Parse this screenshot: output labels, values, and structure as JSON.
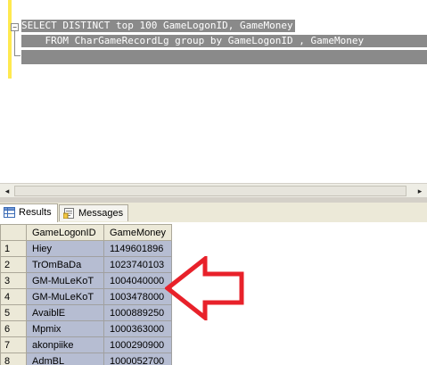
{
  "editor": {
    "sql_line1": "SELECT DISTINCT top 100 GameLogonID, GameMoney",
    "sql_line2": "    FROM CharGameRecordLg group by GameLogonID , GameMoney",
    "collapse_glyph": "−"
  },
  "scrollbar": {
    "left_arrow": "◂",
    "right_arrow": "▸"
  },
  "tabs": [
    {
      "label": "Results",
      "icon": "grid-icon",
      "active": true
    },
    {
      "label": "Messages",
      "icon": "messages-icon",
      "active": false
    }
  ],
  "results": {
    "columns": [
      "GameLogonID",
      "GameMoney"
    ],
    "rows": [
      {
        "num": "1",
        "logon_id": "Hiey",
        "money": "1149601896"
      },
      {
        "num": "2",
        "logon_id": "TrOmBaDa",
        "money": "1023740103"
      },
      {
        "num": "3",
        "logon_id": "GM-MuLeKoT",
        "money": "1004040000"
      },
      {
        "num": "4",
        "logon_id": "GM-MuLeKoT",
        "money": "1003478000"
      },
      {
        "num": "5",
        "logon_id": "AvaiblE",
        "money": "1000889250"
      },
      {
        "num": "6",
        "logon_id": "Mpmix",
        "money": "1000363000"
      },
      {
        "num": "7",
        "logon_id": "akonpiike",
        "money": "1000290900"
      },
      {
        "num": "8",
        "logon_id": "AdmBL",
        "money": "1000052700"
      }
    ]
  },
  "annotation": {
    "arrow_color": "#e8212a"
  }
}
